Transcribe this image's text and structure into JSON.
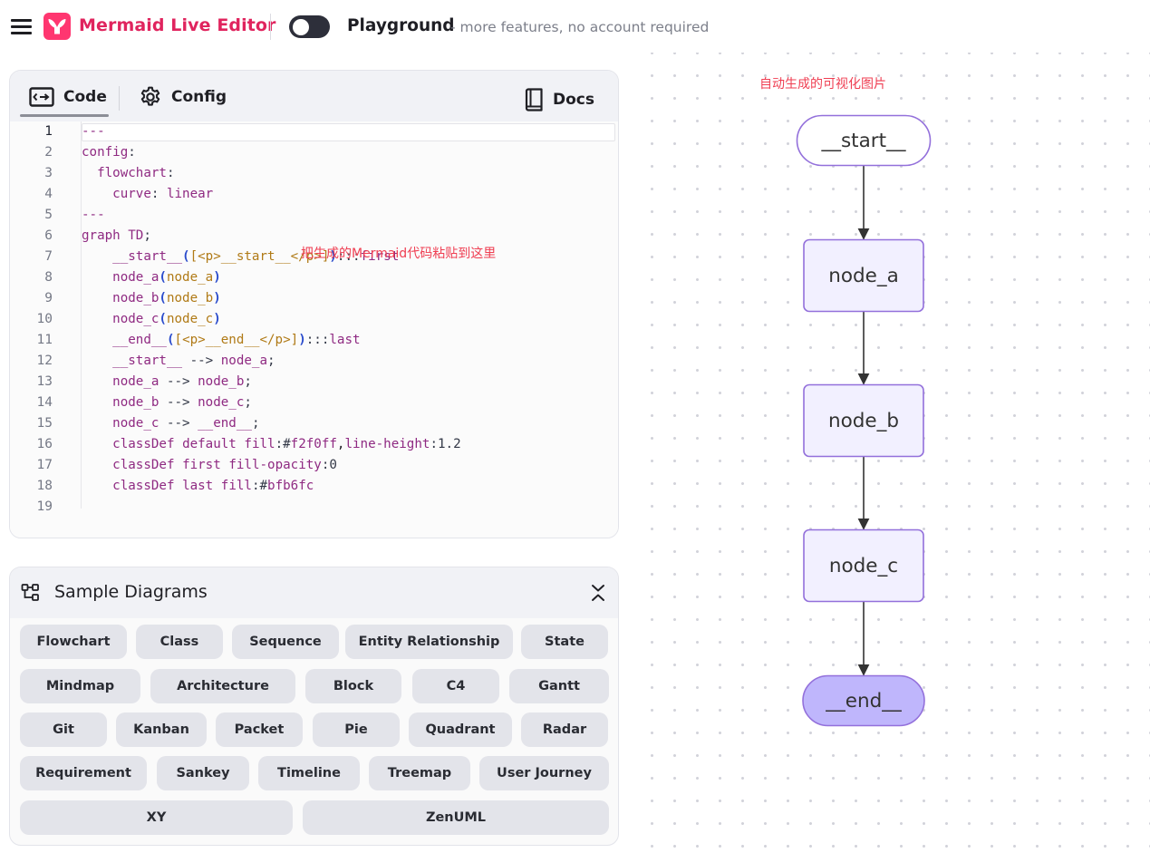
{
  "header": {
    "menu_icon": "hamburger-menu-icon",
    "logo_icon": "mermaid-logo-icon",
    "app_title": "Mermaid Live Editor",
    "playground_toggle": {
      "state": "off"
    },
    "playground_title": "Playground",
    "playground_subtitle": "- more features, no account required"
  },
  "editor": {
    "tabs": [
      {
        "label": "Code",
        "icon": "code-arrow-icon",
        "active": true
      },
      {
        "label": "Config",
        "icon": "gear-icon",
        "active": false
      },
      {
        "label": "Docs",
        "icon": "book-icon",
        "active": false
      }
    ],
    "annotation": "把生成的Mermaid代码粘贴到这里",
    "active_line": 1,
    "lines": [
      "---",
      "config:",
      "  flowchart:",
      "    curve: linear",
      "---",
      "graph TD;",
      "    __start__([<p>__start__</p>]):::first",
      "    node_a(node_a)",
      "    node_b(node_b)",
      "    node_c(node_c)",
      "    __end__([<p>__end__</p>]):::last",
      "    __start__ --> node_a;",
      "    node_a --> node_b;",
      "    node_b --> node_c;",
      "    node_c --> __end__;",
      "    classDef default fill:#f2f0ff,line-height:1.2",
      "    classDef first fill-opacity:0",
      "    classDef last fill:#bfb6fc",
      ""
    ]
  },
  "samples": {
    "title": "Sample Diagrams",
    "icon": "diagram-tree-icon",
    "collapse_icon": "collapse-chevrons-icon",
    "buttons": [
      "Flowchart",
      "Class",
      "Sequence",
      "Entity Relationship",
      "State",
      "Mindmap",
      "Architecture",
      "Block",
      "C4",
      "Gantt",
      "Git",
      "Kanban",
      "Packet",
      "Pie",
      "Quadrant",
      "Radar",
      "Requirement",
      "Sankey",
      "Timeline",
      "Treemap",
      "User Journey",
      "XY",
      "ZenUML"
    ]
  },
  "diagram": {
    "annotation": "自动生成的可视化图片",
    "nodes": [
      {
        "id": "__start__",
        "label": "__start__",
        "shape": "stadium",
        "fill": "#ffffff"
      },
      {
        "id": "node_a",
        "label": "node_a",
        "shape": "rounded",
        "fill": "#f2f0ff"
      },
      {
        "id": "node_b",
        "label": "node_b",
        "shape": "rounded",
        "fill": "#f2f0ff"
      },
      {
        "id": "node_c",
        "label": "node_c",
        "shape": "rounded",
        "fill": "#f2f0ff"
      },
      {
        "id": "__end__",
        "label": "__end__",
        "shape": "stadium",
        "fill": "#bfb6fc"
      }
    ],
    "edges": [
      [
        "__start__",
        "node_a"
      ],
      [
        "node_a",
        "node_b"
      ],
      [
        "node_b",
        "node_c"
      ],
      [
        "node_c",
        "__end__"
      ]
    ],
    "node_stroke": "#9370db",
    "edge_color": "#333333"
  },
  "colors": {
    "brand": "#e0245e",
    "annotation": "#ef3e52"
  }
}
